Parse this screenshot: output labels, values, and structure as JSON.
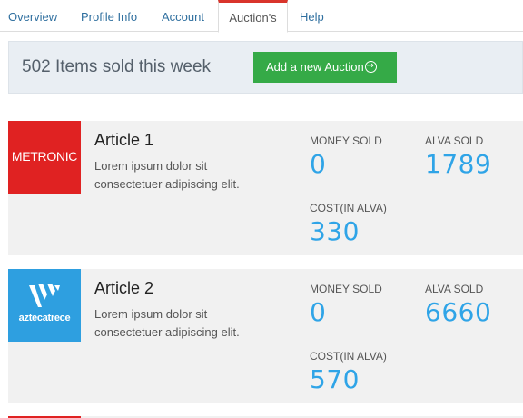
{
  "tabs": [
    {
      "label": "Overview"
    },
    {
      "label": "Profile Info"
    },
    {
      "label": "Account"
    },
    {
      "label": "Auction's"
    },
    {
      "label": "Help"
    }
  ],
  "active_tab": "Auction's",
  "banner": {
    "title": "502 Items sold this week",
    "add_button_label": "Add a new Auction"
  },
  "articles": [
    {
      "logo_text": "METRONIC",
      "logo_icon": "metronic-logo",
      "logo_color": "#e02222",
      "title": "Article 1",
      "description": "Lorem ipsum dolor sit consectetuer adipiscing elit.",
      "money_sold_label": "MONEY SOLD",
      "money_sold": "0",
      "alva_sold_label": "ALVA SOLD",
      "alva_sold": "1789",
      "cost_label": "COST(IN ALVA)",
      "cost": "330"
    },
    {
      "logo_text": "aztecatrece",
      "logo_icon": "azteca-trece-logo",
      "logo_color": "#2e9fe0",
      "title": "Article 2",
      "description": "Lorem ipsum dolor sit consectetuer adipiscing elit.",
      "money_sold_label": "MONEY SOLD",
      "money_sold": "0",
      "alva_sold_label": "ALVA SOLD",
      "alva_sold": "6660",
      "cost_label": "COST(IN ALVA)",
      "cost": "570"
    }
  ],
  "colors": {
    "accent_blue": "#2fa4e7",
    "button_green": "#35aa47",
    "active_tab_red": "#d9342b"
  }
}
